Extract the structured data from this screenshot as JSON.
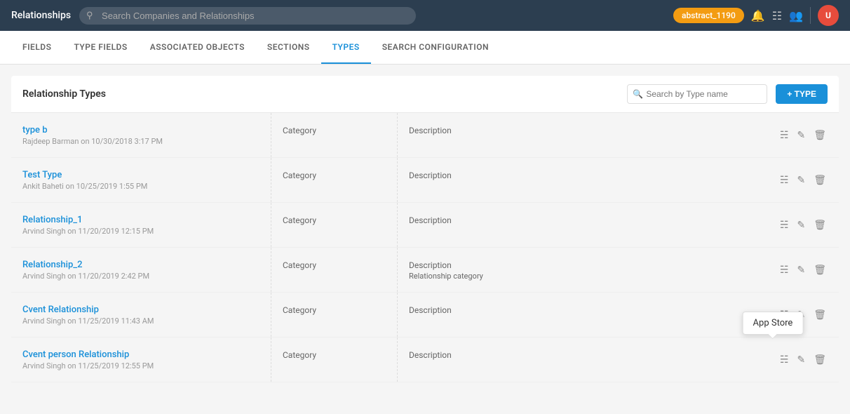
{
  "app": {
    "title": "Relationships",
    "search_placeholder": "Search Companies and Relationships",
    "user_badge": "abstract_1190"
  },
  "tabs": [
    {
      "id": "fields",
      "label": "FIELDS",
      "active": false
    },
    {
      "id": "type-fields",
      "label": "TYPE FIELDS",
      "active": false
    },
    {
      "id": "associated-objects",
      "label": "ASSOCIATED OBJECTS",
      "active": false
    },
    {
      "id": "sections",
      "label": "SECTIONS",
      "active": false
    },
    {
      "id": "types",
      "label": "TYPES",
      "active": true
    },
    {
      "id": "search-configuration",
      "label": "SEARCH CONFIGURATION",
      "active": false
    }
  ],
  "section": {
    "title": "Relationship Types",
    "search_placeholder": "Search by Type name",
    "add_button_label": "+ TYPE"
  },
  "rows": [
    {
      "name": "type b",
      "meta": "Rajdeep Barman on 10/30/2018 3:17 PM",
      "category": "Category",
      "description": "Description",
      "desc_sub": ""
    },
    {
      "name": "Test Type",
      "meta": "Ankit Baheti on 10/25/2019 1:55 PM",
      "category": "Category",
      "description": "Description",
      "desc_sub": ""
    },
    {
      "name": "Relationship_1",
      "meta": "Arvind Singh on 11/20/2019 12:15 PM",
      "category": "Category",
      "description": "Description",
      "desc_sub": ""
    },
    {
      "name": "Relationship_2",
      "meta": "Arvind Singh on 11/20/2019 2:42 PM",
      "category": "Category",
      "description": "Description",
      "desc_sub": "Relationship category"
    },
    {
      "name": "Cvent Relationship",
      "meta": "Arvind Singh on 11/25/2019 11:43 AM",
      "category": "Category",
      "description": "Description",
      "desc_sub": ""
    },
    {
      "name": "Cvent person Relationship",
      "meta": "Arvind Singh on 11/25/2019 12:55 PM",
      "category": "Category",
      "description": "Description",
      "desc_sub": "",
      "show_tooltip": true,
      "tooltip_text": "App Store"
    }
  ],
  "icons": {
    "search": "🔍",
    "bell": "🔔",
    "copy": "⎘",
    "edit": "✏",
    "delete": "🗑",
    "user": "👤",
    "grid": "⊞"
  }
}
